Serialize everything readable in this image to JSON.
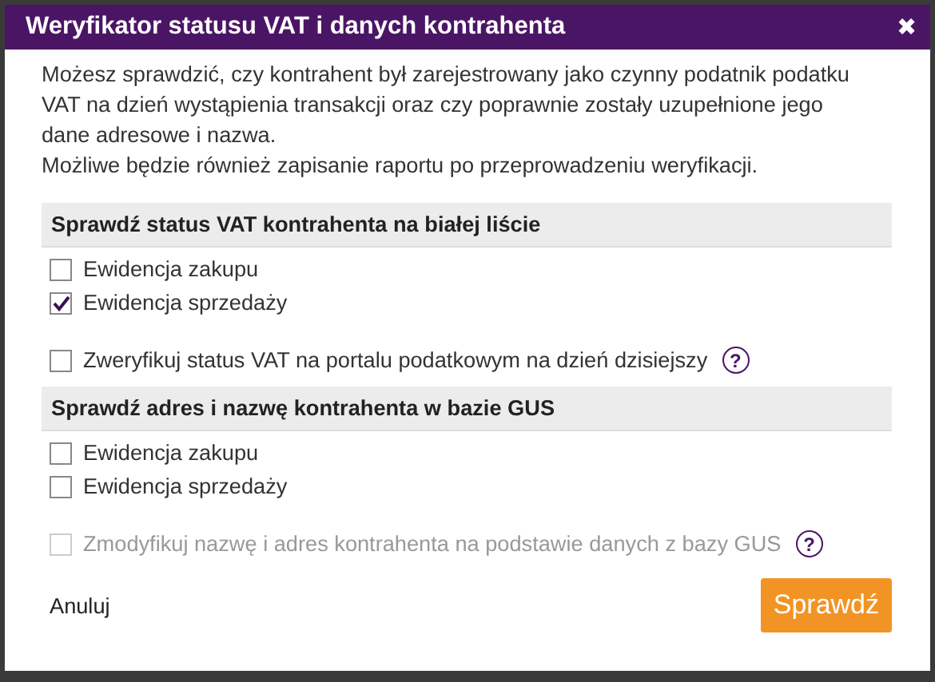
{
  "dialog": {
    "title": "Weryfikator statusu VAT i danych kontrahenta",
    "close": "✖",
    "intro": [
      "Możesz sprawdzić, czy kontrahent był zarejestrowany jako czynny podatnik podatku VAT na dzień wystąpienia transakcji oraz czy poprawnie zostały uzupełnione jego dane adresowe i nazwa.",
      "Możliwe będzie również zapisanie raportu po przeprowadzeniu weryfikacji."
    ],
    "sections": [
      {
        "heading": "Sprawdź status VAT kontrahenta na białej liście",
        "options": [
          {
            "label": "Ewidencja zakupu",
            "checked": false,
            "disabled": false
          },
          {
            "label": "Ewidencja sprzedaży",
            "checked": true,
            "disabled": false
          }
        ],
        "extra": {
          "label": "Zweryfikuj status VAT na portalu podatkowym na dzień dzisiejszy",
          "checked": false,
          "disabled": false,
          "help": "?"
        }
      },
      {
        "heading": "Sprawdź adres i nazwę kontrahenta w bazie GUS",
        "options": [
          {
            "label": "Ewidencja zakupu",
            "checked": false,
            "disabled": false
          },
          {
            "label": "Ewidencja sprzedaży",
            "checked": false,
            "disabled": false
          }
        ],
        "extra": {
          "label": "Zmodyfikuj nazwę i adres kontrahenta na podstawie danych z bazy GUS",
          "checked": false,
          "disabled": true,
          "help": "?"
        }
      }
    ],
    "cancel": "Anuluj",
    "submit": "Sprawdź"
  }
}
